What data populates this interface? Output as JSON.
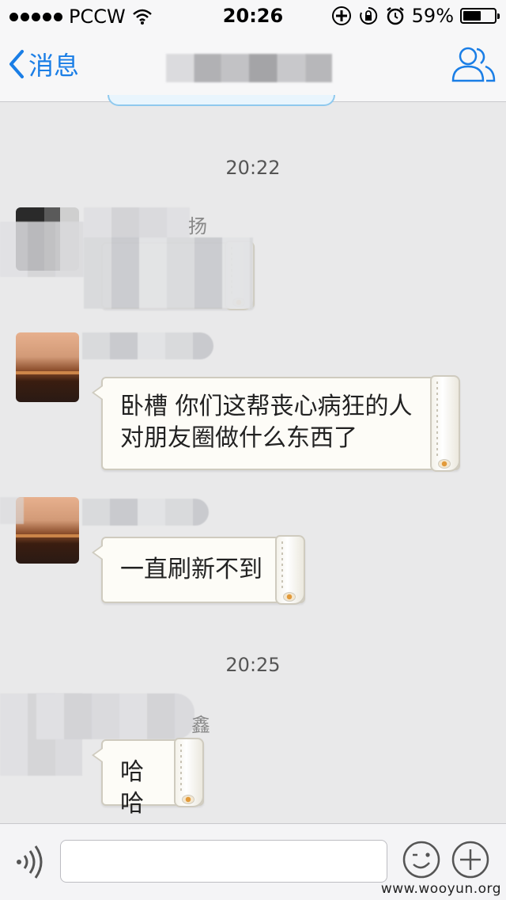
{
  "status_bar": {
    "carrier": "PCCW",
    "time": "20:26",
    "battery_percent": "59%",
    "battery_level": 0.59
  },
  "nav": {
    "back_label": "消息",
    "back_icon": "chevron-left-icon",
    "contacts_icon": "contacts-icon"
  },
  "chat": {
    "timestamps": [
      "20:22",
      "20:25"
    ],
    "messages": [
      {
        "sender_partial": "扬",
        "text": ""
      },
      {
        "sender_partial": "",
        "text": "卧槽 你们这帮丧心病狂的人对朋友圈做什么东西了"
      },
      {
        "sender_partial": "",
        "text": "一直刷新不到"
      },
      {
        "sender_partial": "鑫",
        "text": "哈哈"
      }
    ]
  },
  "input_bar": {
    "voice_icon": "voice-icon",
    "input_value": "",
    "emoji_icon": "emoji-icon",
    "plus_icon": "plus-icon"
  },
  "watermark": "www.wooyun.org",
  "colors": {
    "accent": "#1a7ee6",
    "background": "#e9e9ea",
    "bubble": "#fdfcf7"
  }
}
